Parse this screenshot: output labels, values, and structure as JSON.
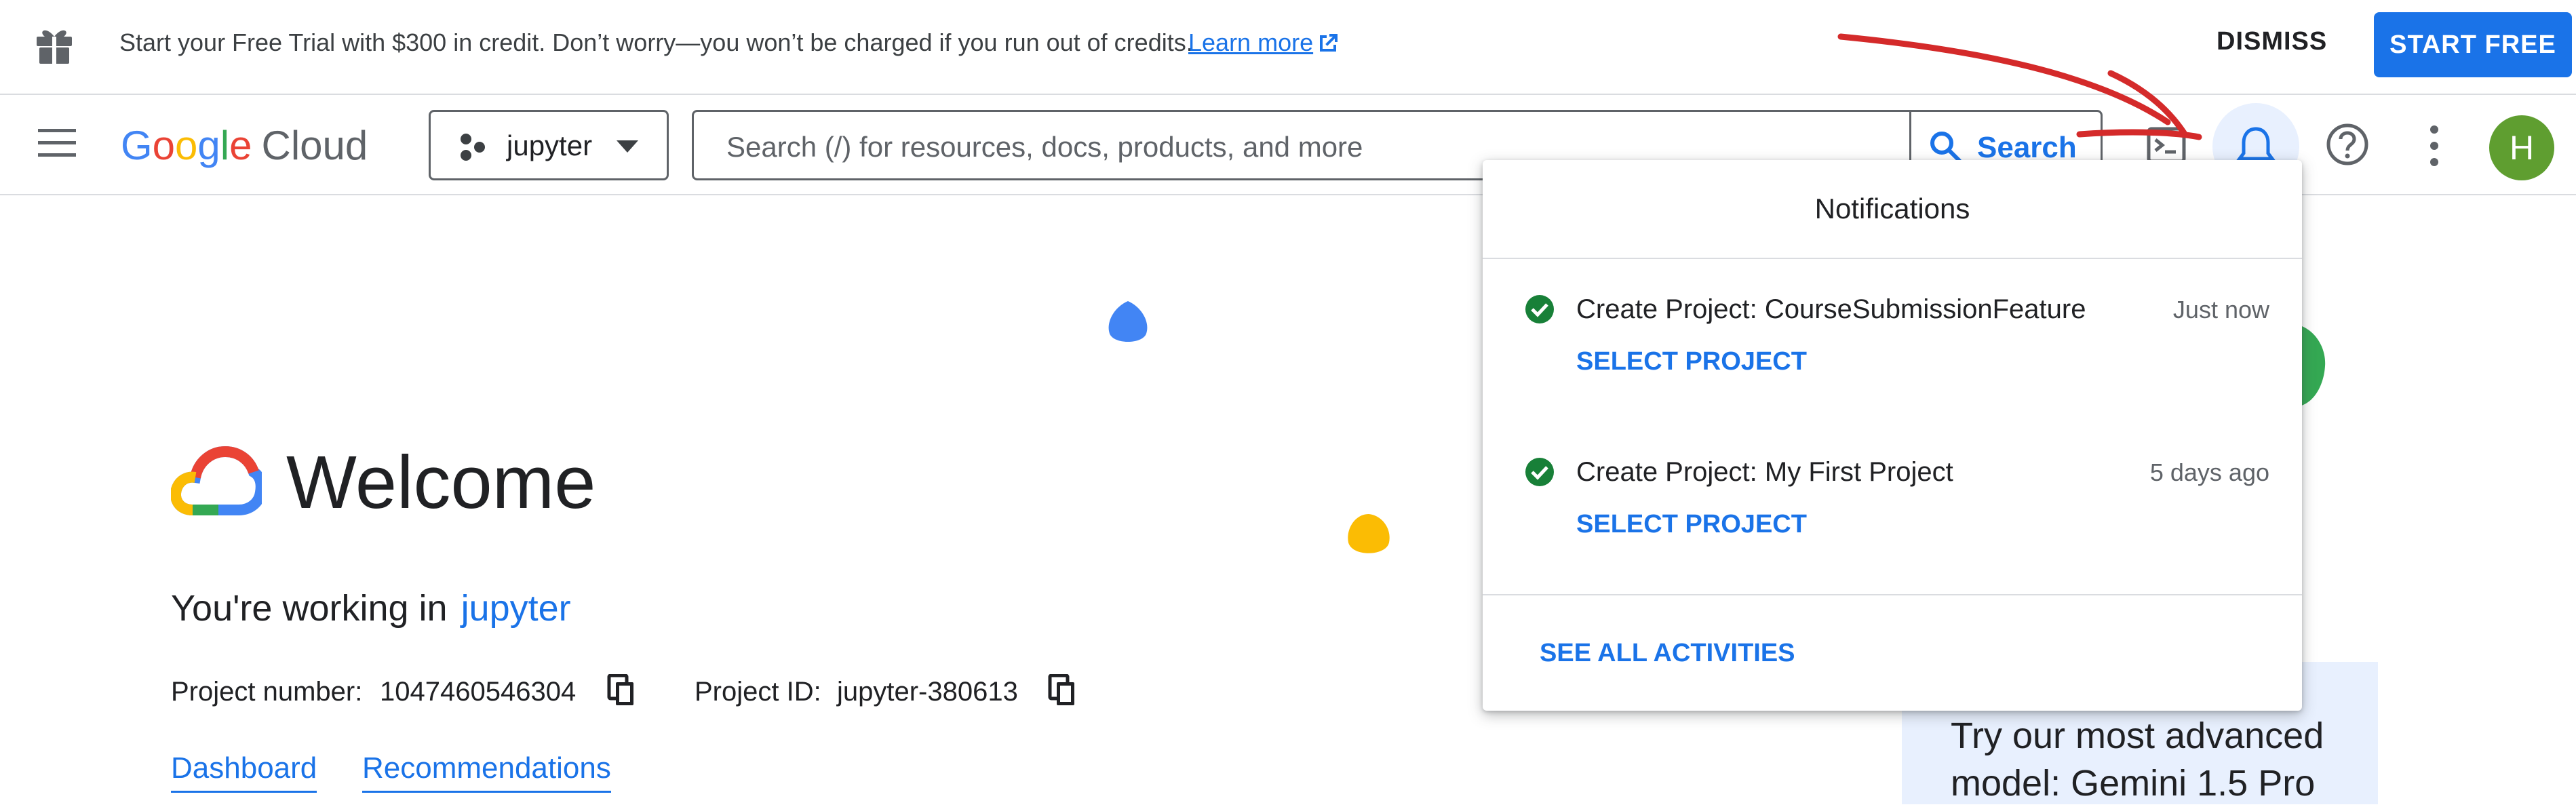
{
  "banner": {
    "message": "Start your Free Trial with $300 in credit. Don’t worry—you won’t be charged if you run out of credits.",
    "learn_more": "Learn more",
    "dismiss": "DISMISS",
    "start_free": "START FREE"
  },
  "header": {
    "logo_google": [
      "G",
      "o",
      "o",
      "g",
      "l",
      "e"
    ],
    "logo_cloud": "Cloud",
    "project_name": "jupyter",
    "search_placeholder": "Search (/) for resources, docs, products, and more",
    "search_label": "Search",
    "avatar_initial": "H"
  },
  "main": {
    "welcome": "Welcome",
    "working_in": "You're working in",
    "working_project": "jupyter",
    "project_number_label": "Project number:",
    "project_number": "1047460546304",
    "project_id_label": "Project ID:",
    "project_id": "jupyter-380613",
    "tabs": [
      "Dashboard",
      "Recommendations"
    ],
    "promo_text": "Try our most advanced model: Gemini 1.5 Pro"
  },
  "notifications": {
    "title": "Notifications",
    "items": [
      {
        "text": "Create Project: CourseSubmissionFeature",
        "time": "Just now",
        "action": "SELECT PROJECT"
      },
      {
        "text": "Create Project: My First Project",
        "time": "5 days ago",
        "action": "SELECT PROJECT"
      }
    ],
    "see_all": "SEE ALL ACTIVITIES"
  },
  "icons": {
    "gift": "gift-icon",
    "external_link": "external-link-icon",
    "menu": "menu-icon",
    "project": "project-icon",
    "dropdown": "dropdown-icon",
    "search": "search-icon",
    "terminal": "cloud-shell-icon",
    "notifications": "bell-icon",
    "help": "help-icon",
    "more": "more-vert-icon",
    "copy": "copy-icon",
    "check": "check-circle-icon"
  },
  "colors": {
    "accent": "#1a73e8",
    "success": "#188038",
    "annotation_arrow": "#d42a2a",
    "blob_blue": "#4285f4",
    "blob_yellow": "#fbbc04",
    "blob_green": "#34a853"
  }
}
